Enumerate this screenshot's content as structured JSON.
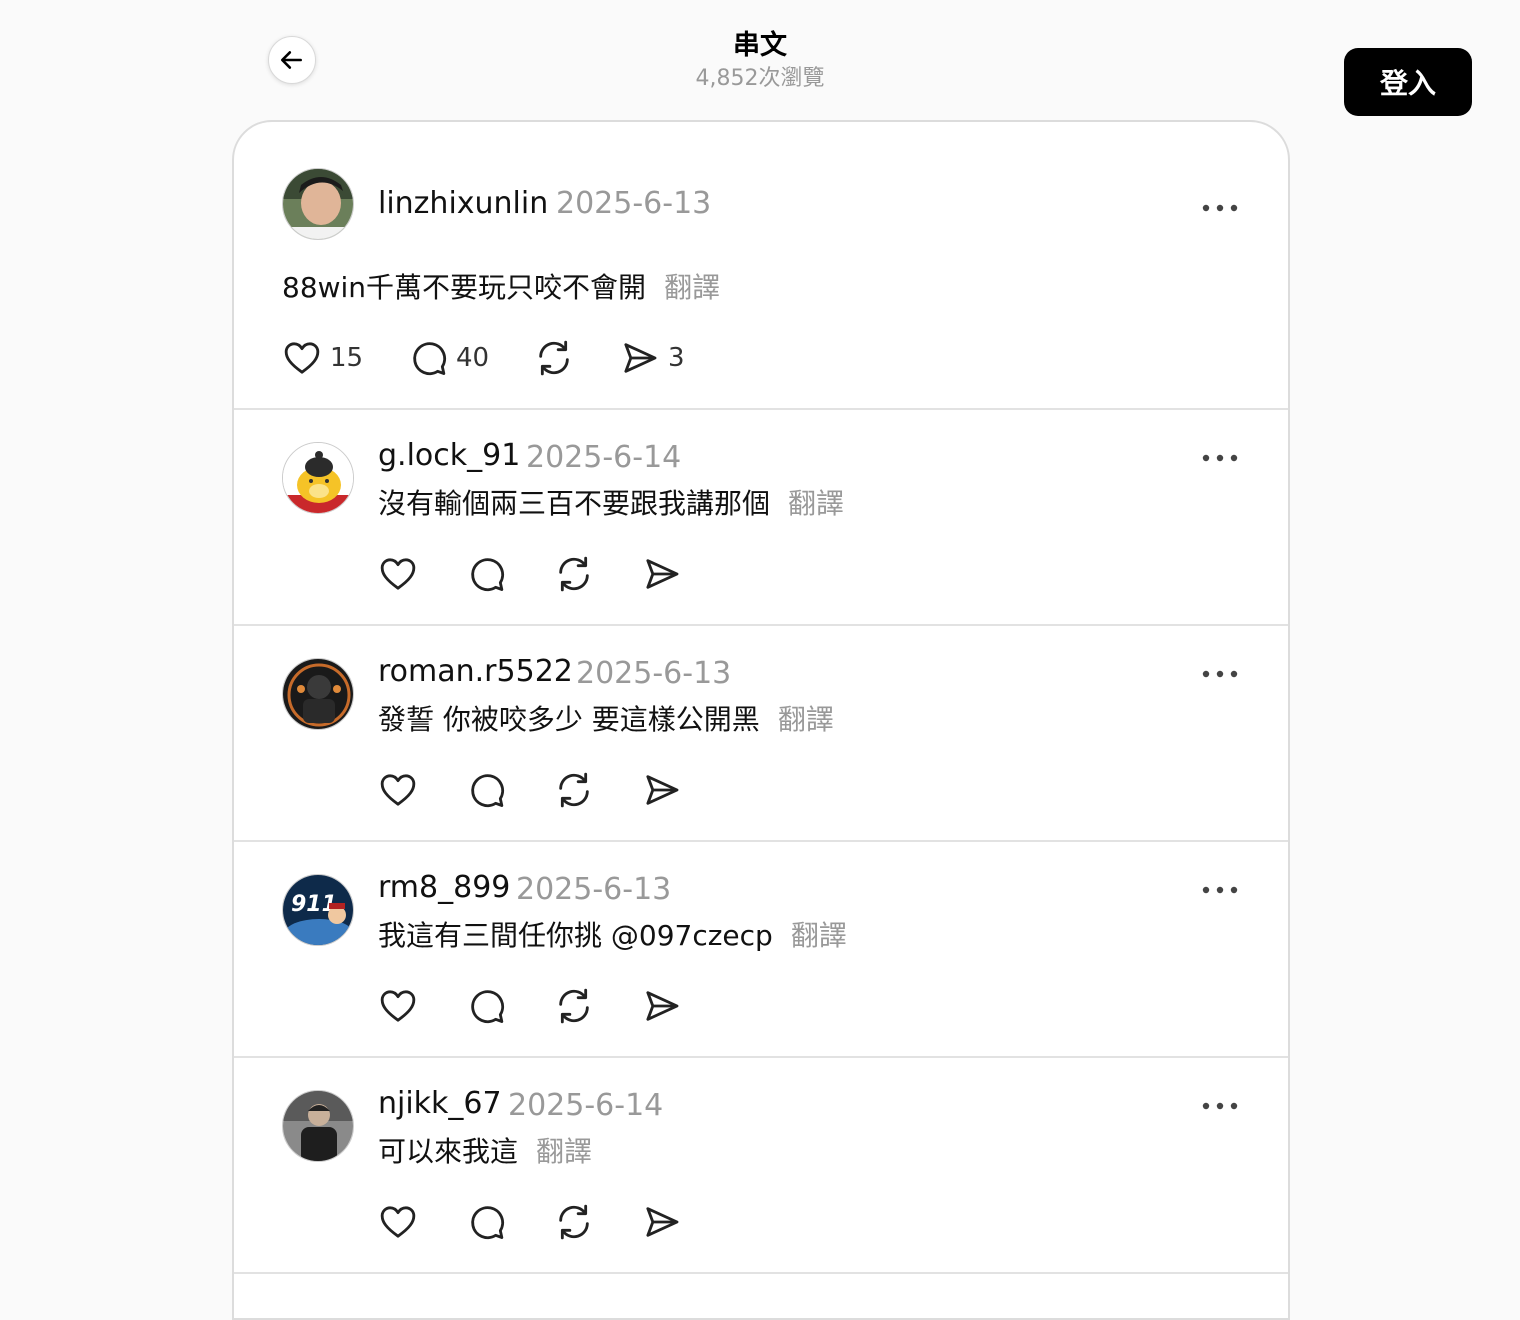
{
  "header": {
    "title": "串文",
    "views": "4,852次瀏覽"
  },
  "login_label": "登入",
  "translate_label": "翻譯",
  "main_post": {
    "username": "linzhixunlin",
    "date": "2025-6-13",
    "text": "88win千萬不要玩只咬不會開",
    "likes": "15",
    "replies": "40",
    "shares": "3"
  },
  "replies": [
    {
      "username": "g.lock_91",
      "date": "2025-6-14",
      "text": "沒有輸個兩三百不要跟我講那個"
    },
    {
      "username": "roman.r5522",
      "date": "2025-6-13",
      "text": "發誓 你被咬多少 要這樣公開黑"
    },
    {
      "username": "rm8_899",
      "date": "2025-6-13",
      "text": "我這有三間任你挑 @097czecp"
    },
    {
      "username": "njikk_67",
      "date": "2025-6-14",
      "text": "可以來我這"
    }
  ],
  "icons": [
    "back-arrow-icon",
    "more-icon",
    "heart-icon",
    "comment-icon",
    "repost-icon",
    "share-icon"
  ]
}
